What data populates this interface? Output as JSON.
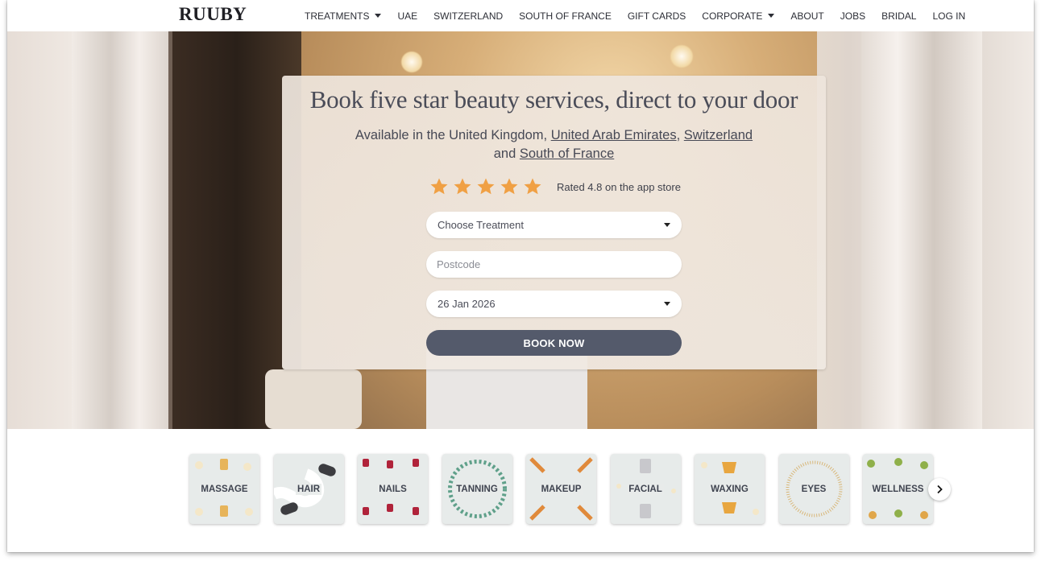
{
  "brand": {
    "logo": "RUUBY"
  },
  "nav": {
    "items": [
      {
        "label": "TREATMENTS",
        "dropdown": true
      },
      {
        "label": "UAE",
        "dropdown": false
      },
      {
        "label": "SWITZERLAND",
        "dropdown": false
      },
      {
        "label": "SOUTH OF FRANCE",
        "dropdown": false
      },
      {
        "label": "GIFT CARDS",
        "dropdown": false
      },
      {
        "label": "CORPORATE",
        "dropdown": true
      },
      {
        "label": "ABOUT",
        "dropdown": false
      },
      {
        "label": "JOBS",
        "dropdown": false
      },
      {
        "label": "BRIDAL",
        "dropdown": false
      },
      {
        "label": "LOG IN",
        "dropdown": false
      }
    ]
  },
  "hero": {
    "headline": "Book five star beauty services, direct to your door",
    "availability_prefix": "Available in the United Kingdom,",
    "link_uae": "United Arab Emirates",
    "comma": ",",
    "link_switzerland": "Switzerland",
    "and_text": "and",
    "link_france": "South of France",
    "rating_stars": 5,
    "rating_text": "Rated 4.8 on the app store",
    "star_color": "#f0a044"
  },
  "form": {
    "treatment_value": "Choose Treatment",
    "postcode_placeholder": "Postcode",
    "date_value": "26 Jan 2026",
    "book_label": "BOOK NOW",
    "book_color": "#545a6b"
  },
  "categories": [
    {
      "label": "MASSAGE"
    },
    {
      "label": "HAIR"
    },
    {
      "label": "NAILS"
    },
    {
      "label": "TANNING"
    },
    {
      "label": "MAKEUP"
    },
    {
      "label": "FACIAL"
    },
    {
      "label": "WAXING"
    },
    {
      "label": "EYES"
    },
    {
      "label": "WELLNESS"
    }
  ],
  "carousel": {
    "next_icon": "chevron-right-icon"
  }
}
